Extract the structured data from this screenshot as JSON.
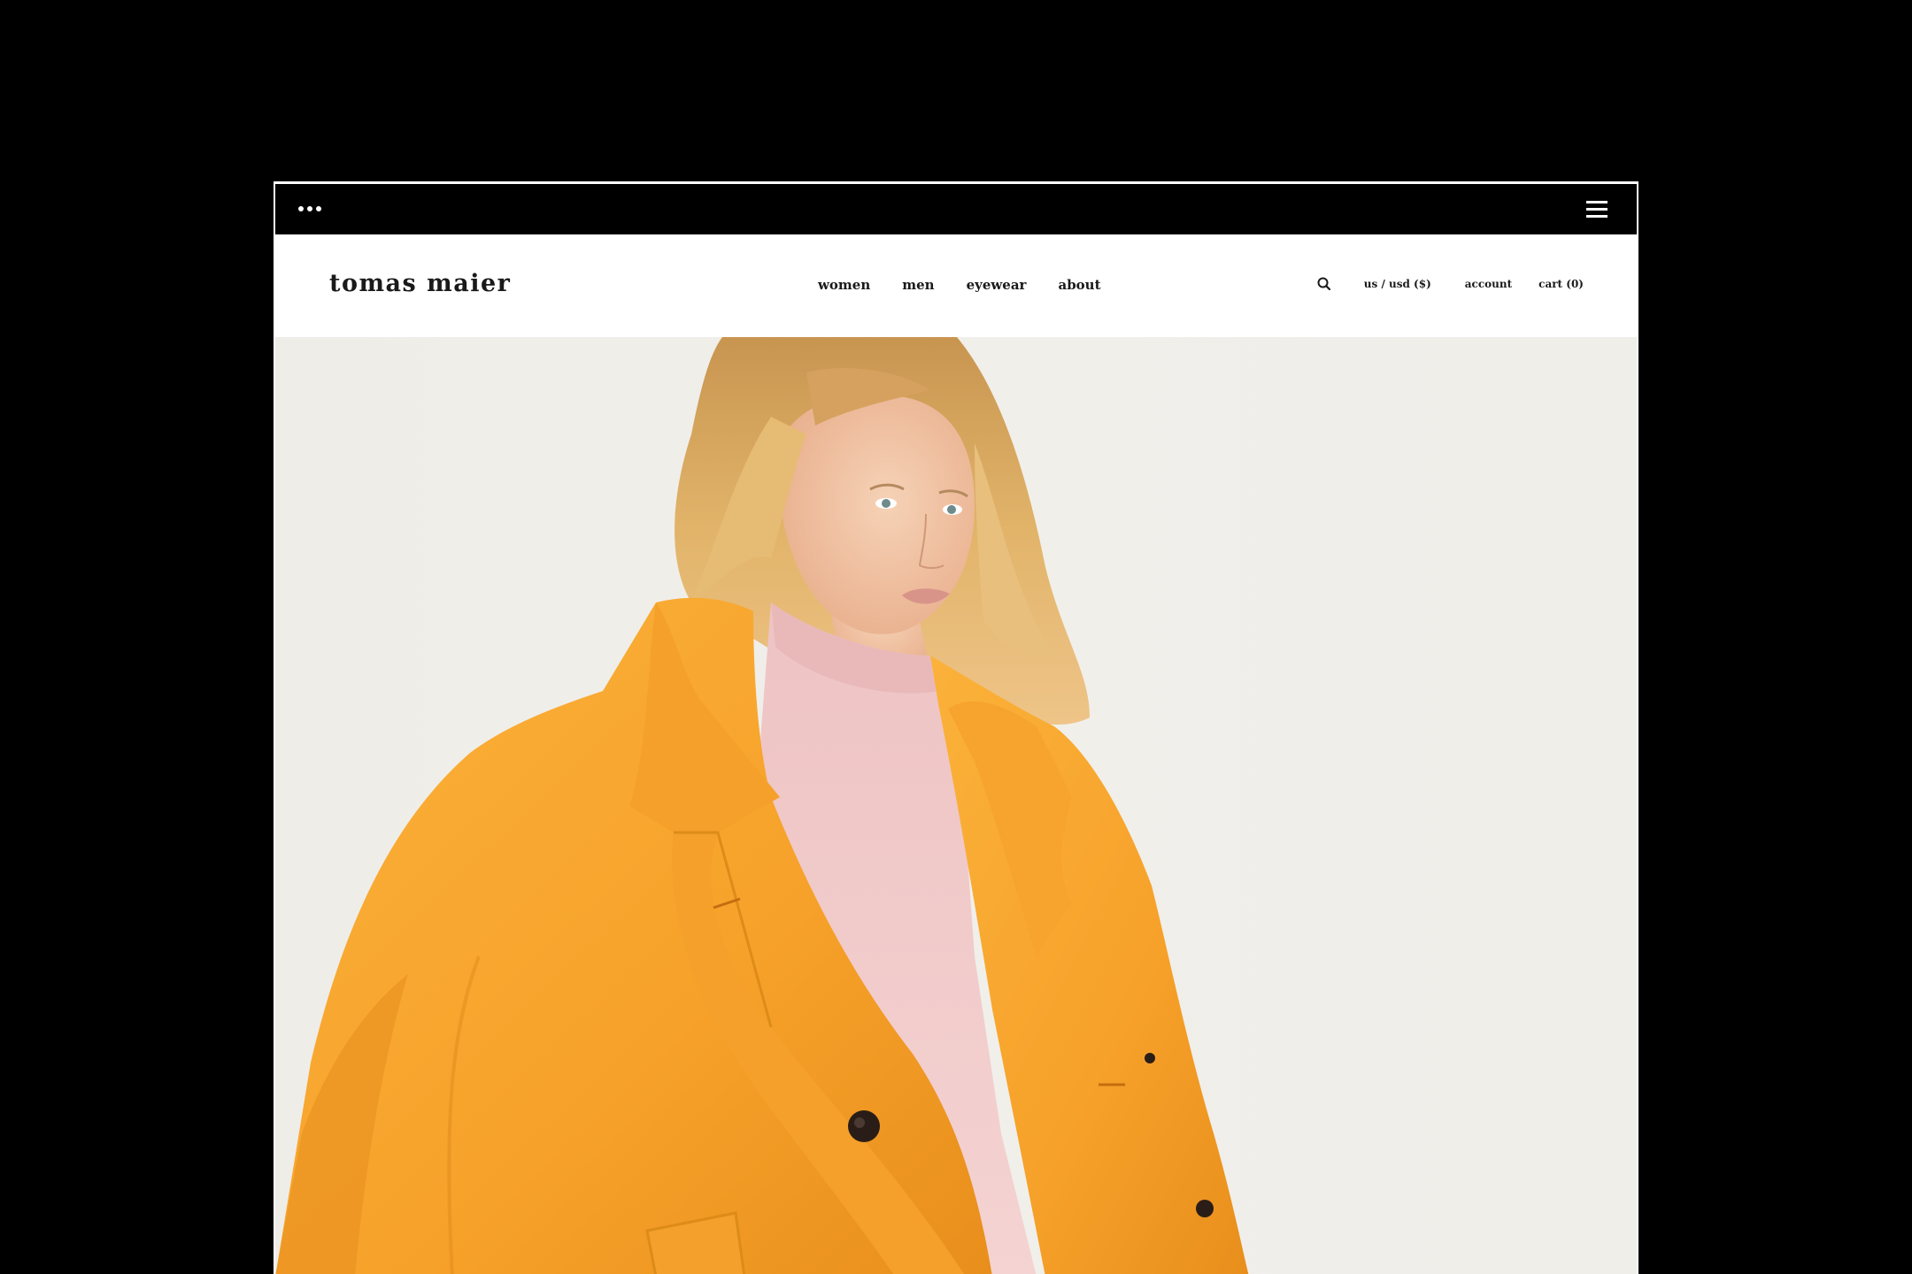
{
  "browser": {
    "menu_icon": "hamburger-menu-icon",
    "dots_icon": "more-dots-icon"
  },
  "header": {
    "logo": "tomas maier",
    "nav": [
      {
        "label": "women"
      },
      {
        "label": "men"
      },
      {
        "label": "eyewear"
      },
      {
        "label": "about"
      }
    ],
    "utility": {
      "search_icon": "search-icon",
      "locale": "us / usd ($)",
      "account": "account",
      "cart": "cart (0)"
    }
  },
  "hero": {
    "image": "model-in-orange-coat-photo",
    "colors": {
      "background": "#efede8",
      "coat": "#f9a72a",
      "sweater": "#f1c9c9",
      "hair": "#d9a95e",
      "skin": "#f2c6a8"
    }
  }
}
